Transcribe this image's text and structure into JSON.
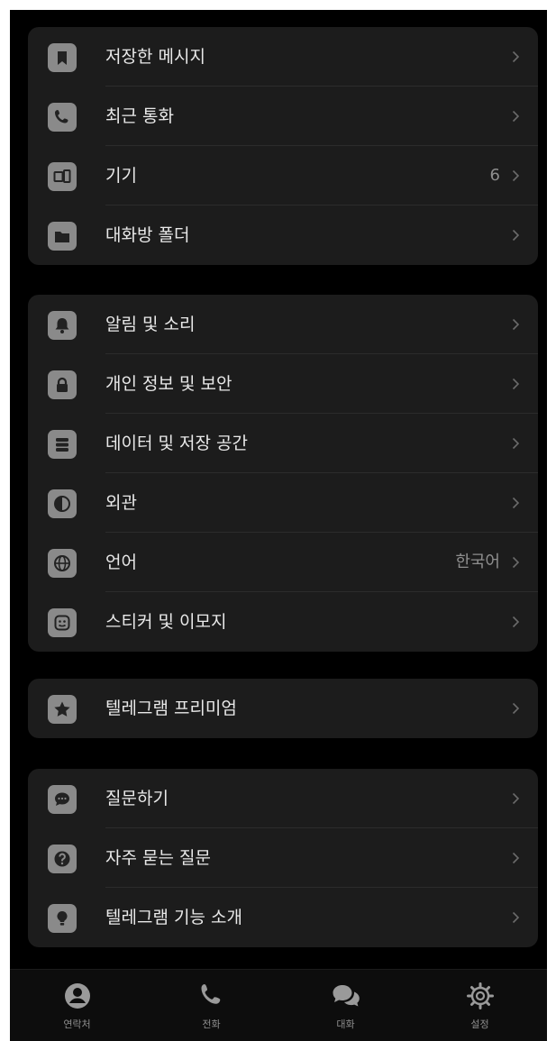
{
  "groups": [
    {
      "items": [
        {
          "label": "저장한 메시지",
          "icon": "bookmark-icon",
          "value": ""
        },
        {
          "label": "최근 통화",
          "icon": "phone-icon",
          "value": ""
        },
        {
          "label": "기기",
          "icon": "devices-icon",
          "value": "6"
        },
        {
          "label": "대화방 폴더",
          "icon": "folder-icon",
          "value": ""
        }
      ]
    },
    {
      "items": [
        {
          "label": "알림 및 소리",
          "icon": "bell-icon",
          "value": ""
        },
        {
          "label": "개인 정보 및 보안",
          "icon": "lock-icon",
          "value": ""
        },
        {
          "label": "데이터 및 저장 공간",
          "icon": "database-icon",
          "value": ""
        },
        {
          "label": "외관",
          "icon": "appearance-icon",
          "value": ""
        },
        {
          "label": "언어",
          "icon": "globe-icon",
          "value": "한국어"
        },
        {
          "label": "스티커 및 이모지",
          "icon": "sticker-icon",
          "value": ""
        }
      ]
    },
    {
      "items": [
        {
          "label": "텔레그램 프리미엄",
          "icon": "star-icon",
          "value": ""
        }
      ]
    },
    {
      "items": [
        {
          "label": "질문하기",
          "icon": "chat-bubble-icon",
          "value": ""
        },
        {
          "label": "자주 묻는 질문",
          "icon": "question-icon",
          "value": ""
        },
        {
          "label": "텔레그램 기능 소개",
          "icon": "lightbulb-icon",
          "value": ""
        }
      ]
    }
  ],
  "tabbar": {
    "tabs": [
      {
        "label": "연락처",
        "icon": "person-icon"
      },
      {
        "label": "전화",
        "icon": "phone-icon"
      },
      {
        "label": "대화",
        "icon": "chats-icon"
      },
      {
        "label": "설정",
        "icon": "gear-icon"
      }
    ]
  },
  "colors": {
    "background": "#000000",
    "group_background": "#1c1c1c",
    "icon_background": "#8a8a8a",
    "label_text": "#e9e9e9",
    "secondary_text": "#8e8e8e"
  }
}
